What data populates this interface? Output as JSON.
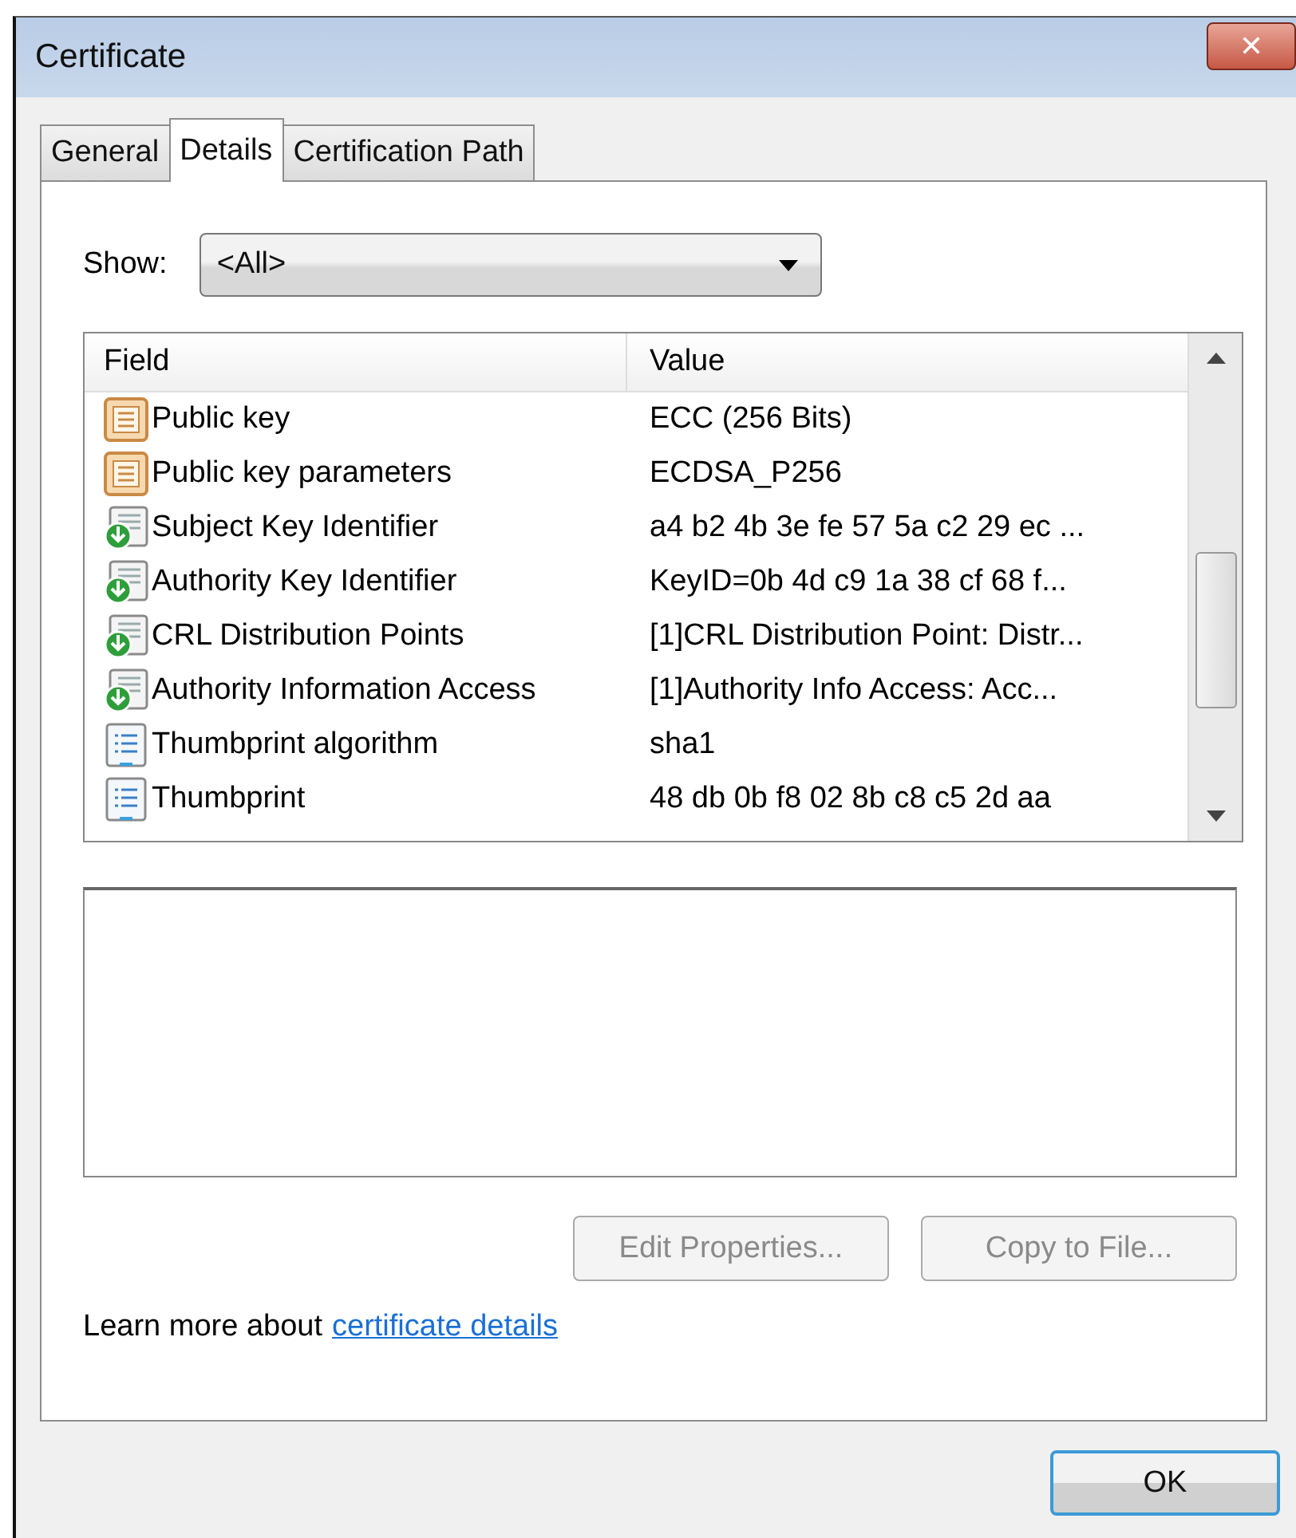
{
  "window": {
    "title": "Certificate",
    "close": "✕"
  },
  "tabs": [
    {
      "label": "General",
      "selected": false
    },
    {
      "label": "Details",
      "selected": true
    },
    {
      "label": "Certification Path",
      "selected": false
    }
  ],
  "show": {
    "label": "Show:",
    "value": "<All>"
  },
  "table": {
    "columns": [
      "Field",
      "Value"
    ],
    "rows": [
      {
        "kind": "key",
        "field": "Public key",
        "value": "ECC (256 Bits)"
      },
      {
        "kind": "key",
        "field": "Public key parameters",
        "value": "ECDSA_P256"
      },
      {
        "kind": "extension",
        "field": "Subject Key Identifier",
        "value": "a4 b2 4b 3e fe 57 5a c2 29 ec ..."
      },
      {
        "kind": "extension",
        "field": "Authority Key Identifier",
        "value": "KeyID=0b 4d c9 1a 38 cf 68 f..."
      },
      {
        "kind": "extension",
        "field": "CRL Distribution Points",
        "value": "[1]CRL Distribution Point: Distr..."
      },
      {
        "kind": "extension",
        "field": "Authority Information Access",
        "value": "[1]Authority Info Access: Acc..."
      },
      {
        "kind": "property",
        "field": "Thumbprint algorithm",
        "value": "sha1"
      },
      {
        "kind": "property",
        "field": "Thumbprint",
        "value": "48 db 0b f8 02 8b c8 c5 2d aa"
      }
    ]
  },
  "buttons": [
    {
      "label": "Edit Properties...",
      "disabled": true
    },
    {
      "label": "Copy to File...",
      "disabled": true
    }
  ],
  "learn_more": {
    "text": "Learn more about",
    "link": "certificate details"
  },
  "ok_button": {
    "label": "OK",
    "disabled": false
  }
}
